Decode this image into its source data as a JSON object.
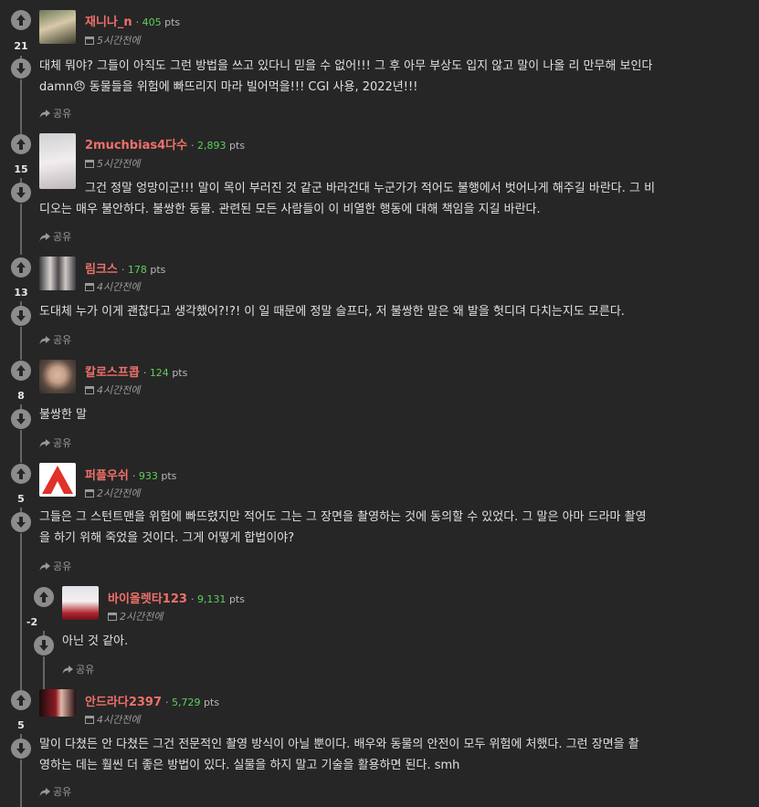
{
  "comments": [
    {
      "user": "재니나_n",
      "pts_num": "405",
      "pts_label": "pts",
      "time": "5시간전에",
      "score": "21",
      "text": "대체 뭐야? 그들이 아직도 그런 방법을 쓰고 있다니 믿을 수 없어!!! 그 후 아무 부상도 입지 않고 말이 나올 리 만무해 보인다",
      "text2": "damn😠 동물들을 위험에 빠뜨리지 마라 빌어먹을!!! CGI 사용, 2022년!!!",
      "share": "공유"
    },
    {
      "user": "2muchbias4다수",
      "pts_num": "2,893",
      "pts_label": "pts",
      "time": "5시간전에",
      "score": "15",
      "text": "그건 정말 엉망이군!!! 말이 목이 부러진 것 같군 바라건대 누군가가 적어도 불행에서 벗어나게 해주길 바란다. 그 비",
      "text2": "디오는 매우 불안하다. 불쌍한 동물. 관련된 모든 사람들이 이 비열한 행동에 대해 책임을 지길 바란다.",
      "share": "공유"
    },
    {
      "user": "림크스",
      "pts_num": "178",
      "pts_label": "pts",
      "time": "4시간전에",
      "score": "13",
      "text": "도대체 누가 이게 괜찮다고 생각했어?!?! 이 일 때문에 정말 슬프다, 저 불쌍한 말은 왜 발을 헛디뎌 다치는지도 모른다.",
      "share": "공유"
    },
    {
      "user": "칼로스프콥",
      "pts_num": "124",
      "pts_label": "pts",
      "time": "4시간전에",
      "score": "8",
      "text": "불쌍한 말",
      "share": "공유"
    },
    {
      "user": "퍼플우쉬",
      "pts_num": "933",
      "pts_label": "pts",
      "time": "2시간전에",
      "score": "5",
      "text": "그들은 그 스턴트맨을 위험에 빠뜨렸지만 적어도 그는 그 장면을 촬영하는 것에 동의할 수 있었다. 그 말은 아마 드라마 촬영",
      "text2": "을 하기 위해 죽었을 것이다. 그게 어떻게 합법이야?",
      "share": "공유"
    },
    {
      "user": "바이올렛타123",
      "pts_num": "9,131",
      "pts_label": "pts",
      "time": "2시간전에",
      "score": "-2",
      "text": "아닌 것 같아.",
      "share": "공유"
    },
    {
      "user": "안드라다2397",
      "pts_num": "5,729",
      "pts_label": "pts",
      "time": "4시간전에",
      "score": "5",
      "text": "말이 다쳤든 안 다쳤든 그건 전문적인 촬영 방식이 아닐 뿐이다. 배우와 동물의 안전이 모두 위험에 처했다. 그런 장면을 촬",
      "text2": "영하는 데는 훨씬 더 좋은 방법이 있다. 실물을 하지 말고 기술을 활용하면 된다. smh",
      "share": "공유"
    }
  ],
  "colors": {
    "background": "#262626",
    "username": "#f0706a",
    "points": "#5fcf5a",
    "vote_button": "#8c8c8c"
  },
  "icons": {
    "upvote": "arrow-up-icon",
    "downvote": "arrow-down-icon",
    "time": "calendar-icon",
    "share": "share-icon"
  }
}
